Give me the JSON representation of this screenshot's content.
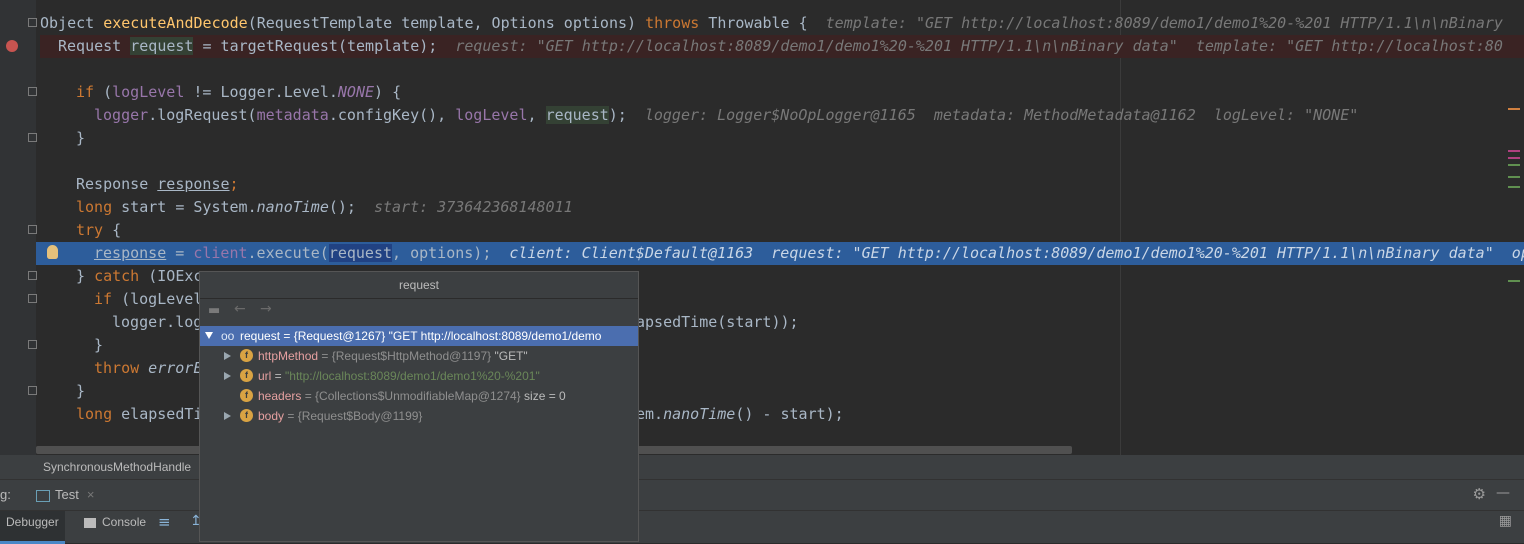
{
  "editor": {
    "lines": {
      "l1": {
        "a": "Object ",
        "b": "executeAndDecode",
        "c": "(RequestTemplate template, Options options) ",
        "d": "throws",
        "e": " Throwable {",
        "hint": "template: \"GET http://localhost:8089/demo1/demo1%20-%201 HTTP/1.1\\n\\nBinary"
      },
      "l2": {
        "a": "Request ",
        "b": "request",
        "c": " = targetRequest(template);",
        "hint": "request: \"GET http://localhost:8089/demo1/demo1%20-%201 HTTP/1.1\\n\\nBinary data\"  template: \"GET http://localhost:80"
      },
      "l3": {
        "a": "if",
        "b": " (",
        "c": "logLevel",
        "d": " != Logger.Level.",
        "e": "NONE",
        "f": ") {"
      },
      "l4": {
        "a": "logger",
        "b": ".logRequest(",
        "c": "metadata",
        "d": ".configKey(), ",
        "e": "logLevel",
        "f": ", ",
        "g": "request",
        "h": ");",
        "hint": "logger: Logger$NoOpLogger@1165  metadata: MethodMetadata@1162  logLevel: \"NONE\""
      },
      "l5": {
        "a": "}"
      },
      "l6": {
        "a": "Response ",
        "b": "response",
        "c": ";"
      },
      "l7": {
        "a": "long",
        "b": " start = System.",
        "c": "nanoTime",
        "d": "();",
        "hint": "start: 373642368148011"
      },
      "l8": {
        "a": "try",
        "b": " {"
      },
      "l9": {
        "a": "response",
        "b": " = ",
        "c": "client",
        "d": ".execute(",
        "e": "request",
        "f": ", options);",
        "hint": "client: Client$Default@1163  request: \"GET http://localhost:8089/demo1/demo1%20-%201 HTTP/1.1\\n\\nBinary data\"  op"
      },
      "l10": {
        "a": "} ",
        "b": "catch",
        "c": " (IOExc"
      },
      "l11": {
        "a": "if",
        "b": " (logLevel"
      },
      "l12": {
        "a": "logger.log",
        "b": "apsedTime(start));"
      },
      "l13": {
        "a": "}"
      },
      "l14": {
        "a": "throw",
        "b": " errorE"
      },
      "l15": {
        "a": "}"
      },
      "l16": {
        "a": "long",
        "b": " elapsedTi",
        "c": "em.",
        "d": "nanoTime",
        "e": "() - start);"
      }
    }
  },
  "status": {
    "breadcrumb": "SynchronousMethodHandle"
  },
  "toolbar": {
    "label": "g:",
    "run_tab": "Test"
  },
  "tabs": {
    "debugger": "Debugger",
    "console": "Console"
  },
  "popup": {
    "title": "request",
    "rows": {
      "root": {
        "name": "request",
        "type": " = {Request@1267} ",
        "value": "\"GET http://localhost:8089/demo1/demo"
      },
      "httpMethod": {
        "name": "httpMethod",
        "type": " = {Request$HttpMethod@1197} ",
        "value": "\"GET\""
      },
      "url": {
        "name": "url",
        "eq": " = ",
        "value": "\"http://localhost:8089/demo1/demo1%20-%201\""
      },
      "headers": {
        "name": "headers",
        "type": " = {Collections$UnmodifiableMap@1274} ",
        "value": " size = 0"
      },
      "body": {
        "name": "body",
        "type": " = {Request$Body@1199}"
      }
    }
  },
  "colors": {
    "keyword": "#cc7832",
    "method": "#ffc66d",
    "field": "#9876aa",
    "selection": "#2d5d9b",
    "popup_selection": "#4b6eaf"
  }
}
